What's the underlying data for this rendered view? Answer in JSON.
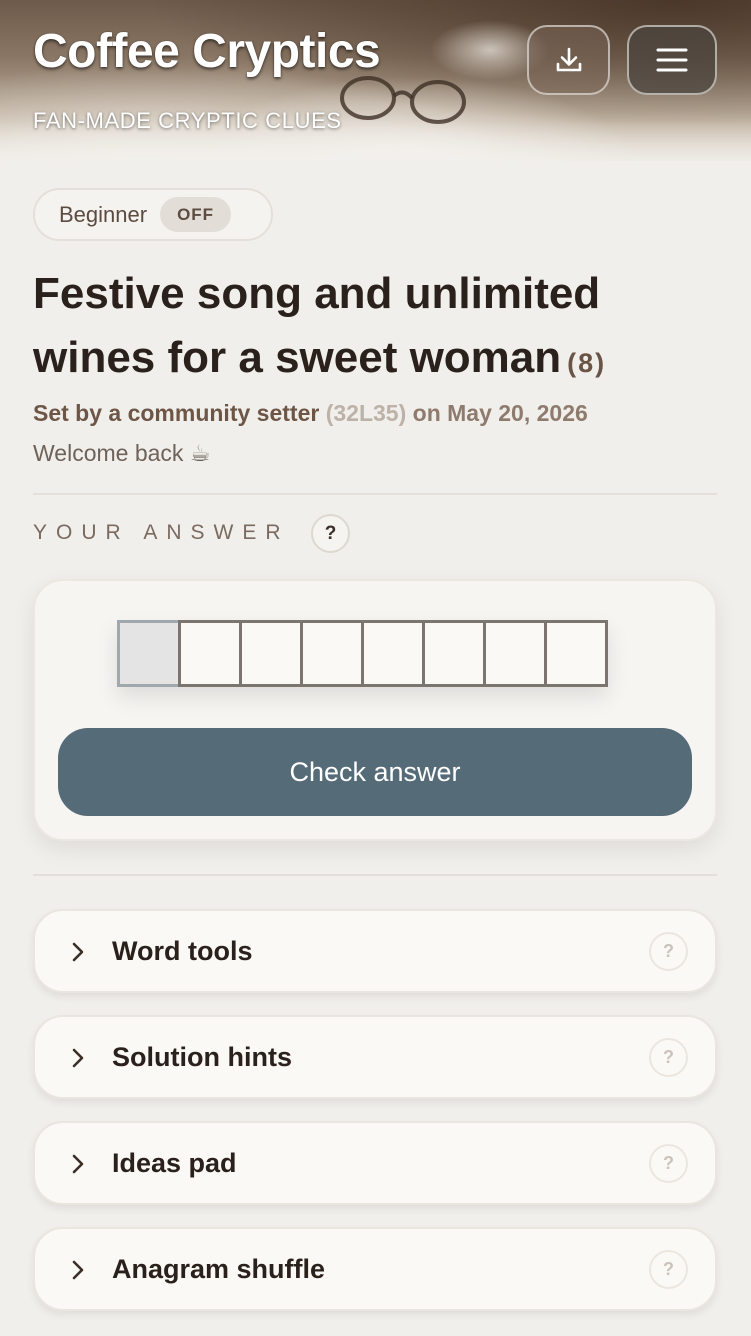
{
  "header": {
    "title": "Coffee Cryptics",
    "subtitle": "FAN-MADE CRYPTIC CLUES",
    "download_icon": "download-icon",
    "menu_icon": "hamburger-menu-icon"
  },
  "mode_chip": {
    "label": "Beginner",
    "toggle_value": "OFF"
  },
  "clue": {
    "text": "Festive song and unlimited wines for a sweet woman",
    "length": "(8)"
  },
  "setter": {
    "prefix": "Set by a community setter",
    "code": "(32L35)",
    "date": "on May 20, 2026"
  },
  "greeting": {
    "text": "Welcome back",
    "icon": "☕"
  },
  "answer": {
    "label": "YOUR ANSWER",
    "help": "?",
    "letter_count": 8,
    "active_cell": 0,
    "check_label": "Check answer"
  },
  "panels": [
    {
      "title": "Word tools",
      "help": "?",
      "icon": "chevron-right-icon"
    },
    {
      "title": "Solution hints",
      "help": "?",
      "icon": "chevron-right-icon"
    },
    {
      "title": "Ideas pad",
      "help": "?",
      "icon": "chevron-right-icon"
    },
    {
      "title": "Anagram shuffle",
      "help": "?",
      "icon": "chevron-right-icon"
    }
  ],
  "colors": {
    "background": "#f1efeb",
    "check_button": "#566b78",
    "text_primary": "#2b211c",
    "text_secondary": "#6e5647"
  }
}
